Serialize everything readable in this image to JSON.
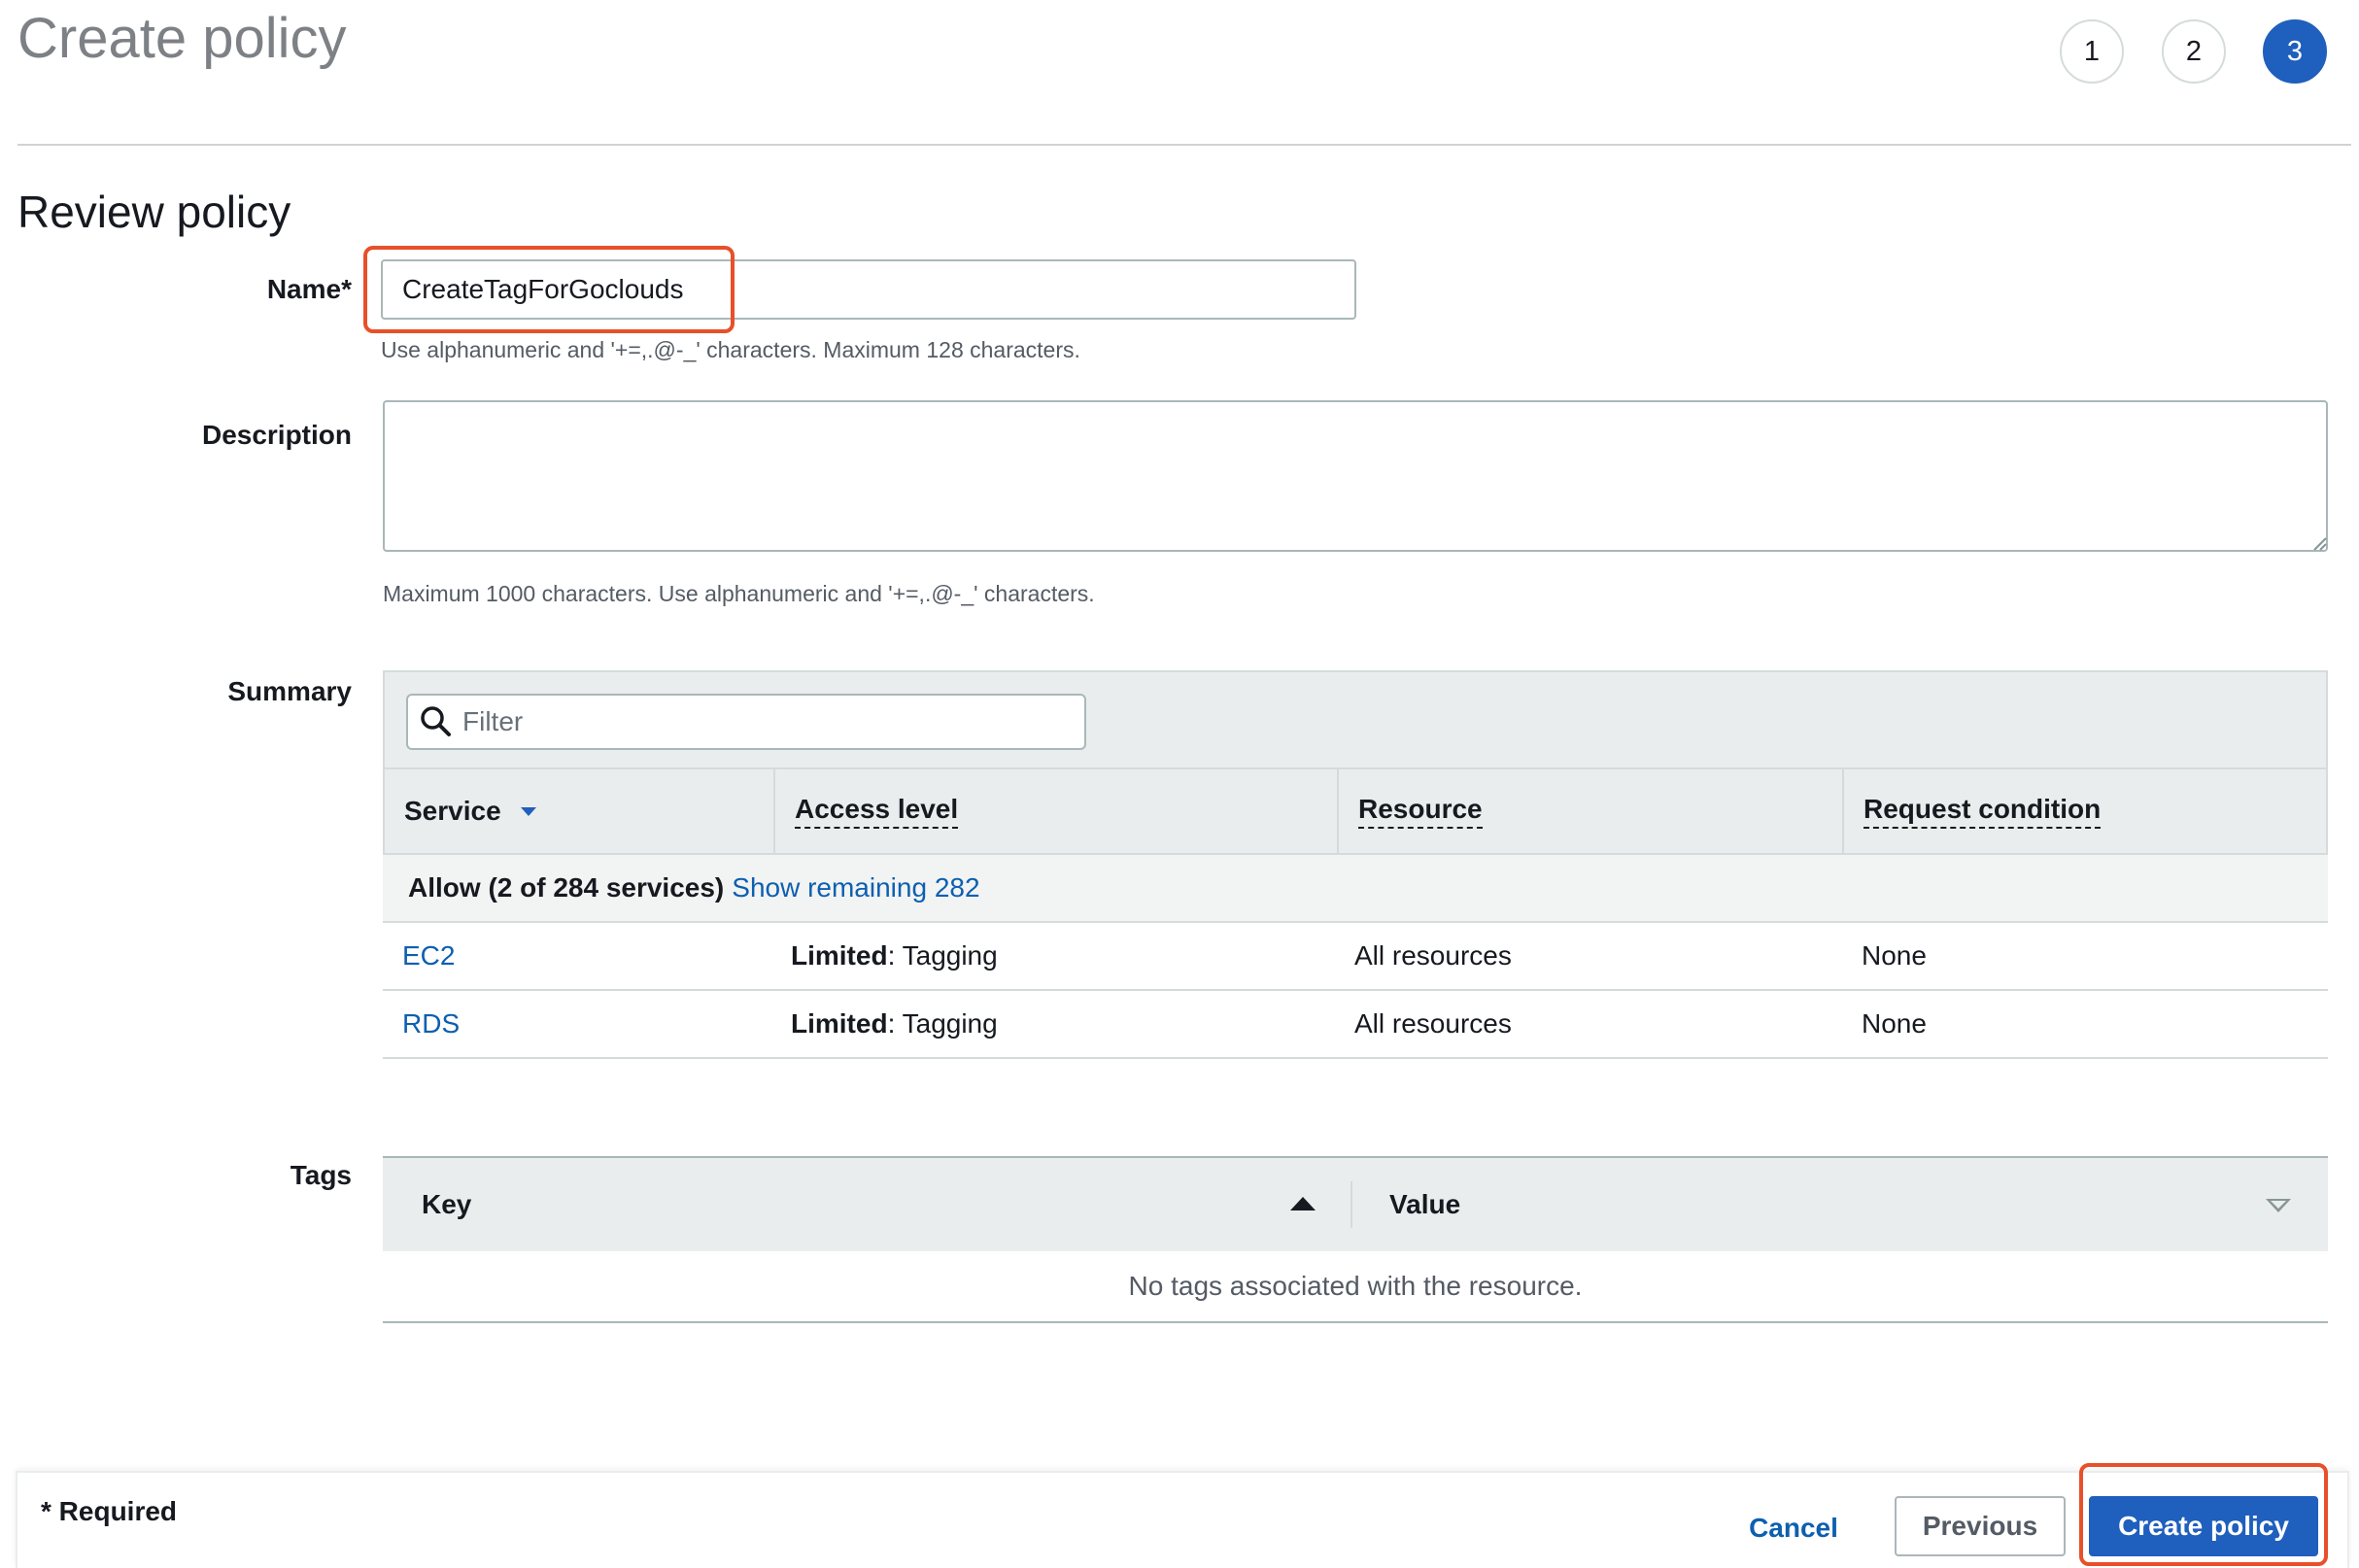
{
  "header": {
    "title": "Create policy",
    "steps": [
      "1",
      "2",
      "3"
    ],
    "active_step": 3
  },
  "section": {
    "title": "Review policy"
  },
  "name": {
    "label": "Name*",
    "value": "CreateTagForGoclouds",
    "hint": "Use alphanumeric and '+=,.@-_' characters. Maximum 128 characters."
  },
  "description": {
    "label": "Description",
    "value": "",
    "hint": "Maximum 1000 characters. Use alphanumeric and '+=,.@-_' characters."
  },
  "summary": {
    "label": "Summary",
    "filter_placeholder": "Filter",
    "columns": [
      "Service",
      "Access level",
      "Resource",
      "Request condition"
    ],
    "group": {
      "text": "Allow (2 of 284 services)",
      "link": "Show remaining 282"
    },
    "rows": [
      {
        "service": "EC2",
        "access_bold": "Limited",
        "access_rest": ": Tagging",
        "resource": "All resources",
        "condition": "None"
      },
      {
        "service": "RDS",
        "access_bold": "Limited",
        "access_rest": ": Tagging",
        "resource": "All resources",
        "condition": "None"
      }
    ]
  },
  "tags": {
    "label": "Tags",
    "columns": [
      "Key",
      "Value"
    ],
    "empty_text": "No tags associated with the resource."
  },
  "footer": {
    "required_note": "* Required",
    "cancel": "Cancel",
    "previous": "Previous",
    "create": "Create policy"
  },
  "colors": {
    "accent": "#1f5fbd",
    "link": "#0d5fb0",
    "highlight": "#e8502a"
  },
  "icons": {
    "search": "search-icon",
    "sort_down": "caret-down-icon",
    "sort_up": "caret-up-icon",
    "value_sort": "chevron-down-icon"
  }
}
